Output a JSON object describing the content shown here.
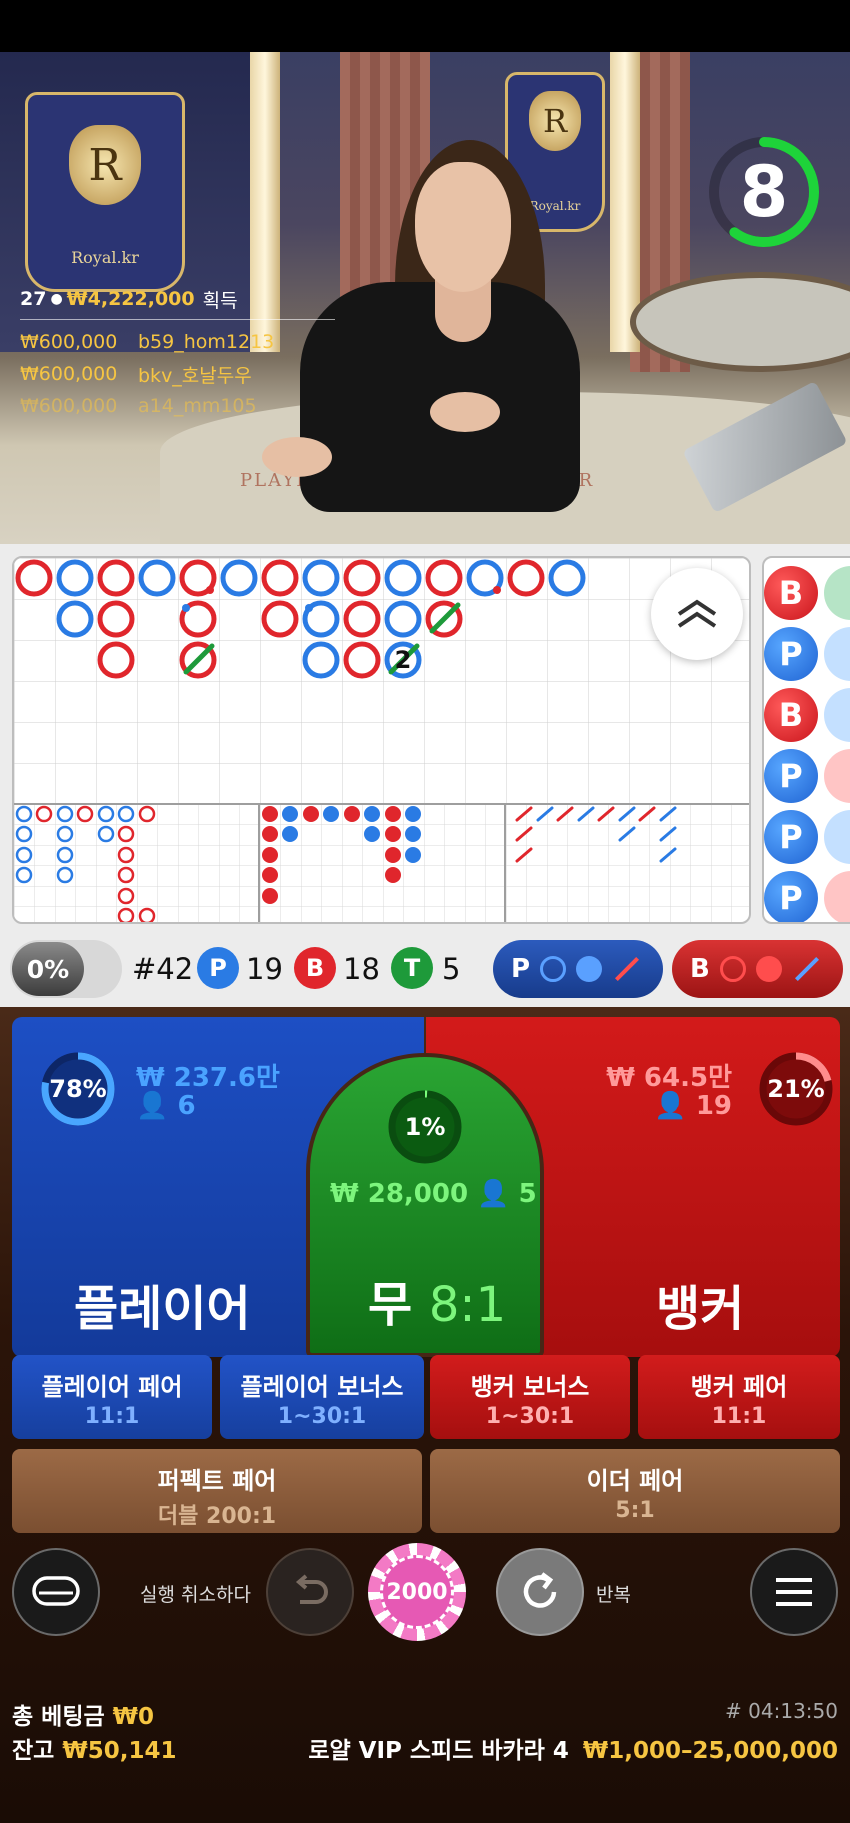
{
  "video": {
    "brand": "Royal.kr",
    "crest_letter": "R",
    "table_left": "PLAYER",
    "table_right": "BANKER",
    "timer": "8",
    "timer_fraction": 0.6
  },
  "winners": {
    "count": "27",
    "total": "₩4,222,000",
    "label": "획득",
    "list": [
      {
        "amount": "₩600,000",
        "name": "b59_hom1213"
      },
      {
        "amount": "₩600,000",
        "name": "bkv_호날두우"
      },
      {
        "amount": "₩600,000",
        "name": "a14_mm105"
      }
    ]
  },
  "roadmap": {
    "big_road_marker": "2",
    "side_badges": [
      "B",
      "P",
      "B",
      "P",
      "P",
      "P"
    ]
  },
  "stats": {
    "percent": "0%",
    "round": "#42",
    "player_letter": "P",
    "player_count": "19",
    "banker_letter": "B",
    "banker_count": "18",
    "tie_letter": "T",
    "tie_count": "5",
    "player_ask": "P",
    "banker_ask": "B"
  },
  "bets": {
    "player": {
      "name": "플레이어",
      "amount": "₩ 237.6만",
      "users": "6",
      "percent": "78%",
      "ratio": 0.78
    },
    "tie": {
      "name": "무",
      "payout": "8:1",
      "amount": "₩ 28,000",
      "users": "5",
      "percent": "1%",
      "ratio": 0.01
    },
    "banker": {
      "name": "뱅커",
      "amount": "₩ 64.5만",
      "users": "19",
      "percent": "21%",
      "ratio": 0.21
    }
  },
  "side_bets": [
    {
      "label": "플레이어 페어",
      "payout": "11:1"
    },
    {
      "label": "플레이어 보너스",
      "payout": "1~30:1"
    },
    {
      "label": "뱅커 보너스",
      "payout": "1~30:1"
    },
    {
      "label": "뱅커 페어",
      "payout": "11:1"
    },
    {
      "label": "퍼펙트 페어",
      "payout": "더블 200:1"
    },
    {
      "label": "이더 페어",
      "payout": "5:1"
    }
  ],
  "controls": {
    "undo_label": "실행 취소하다",
    "chip_value": "2000",
    "repeat_label": "반복"
  },
  "footer": {
    "total_bet_label": "총 베팅금",
    "total_bet_value": "₩0",
    "balance_label": "잔고",
    "balance_value": "₩50,141",
    "round_id": "# 04:13:50",
    "table_name": "로얄 VIP 스피드 바카라 4",
    "limits": "₩1,000–25,000,000"
  },
  "colors": {
    "player": "#1d4fc4",
    "banker": "#d31a1a",
    "tie": "#2aa533",
    "gold": "#f6c542"
  }
}
